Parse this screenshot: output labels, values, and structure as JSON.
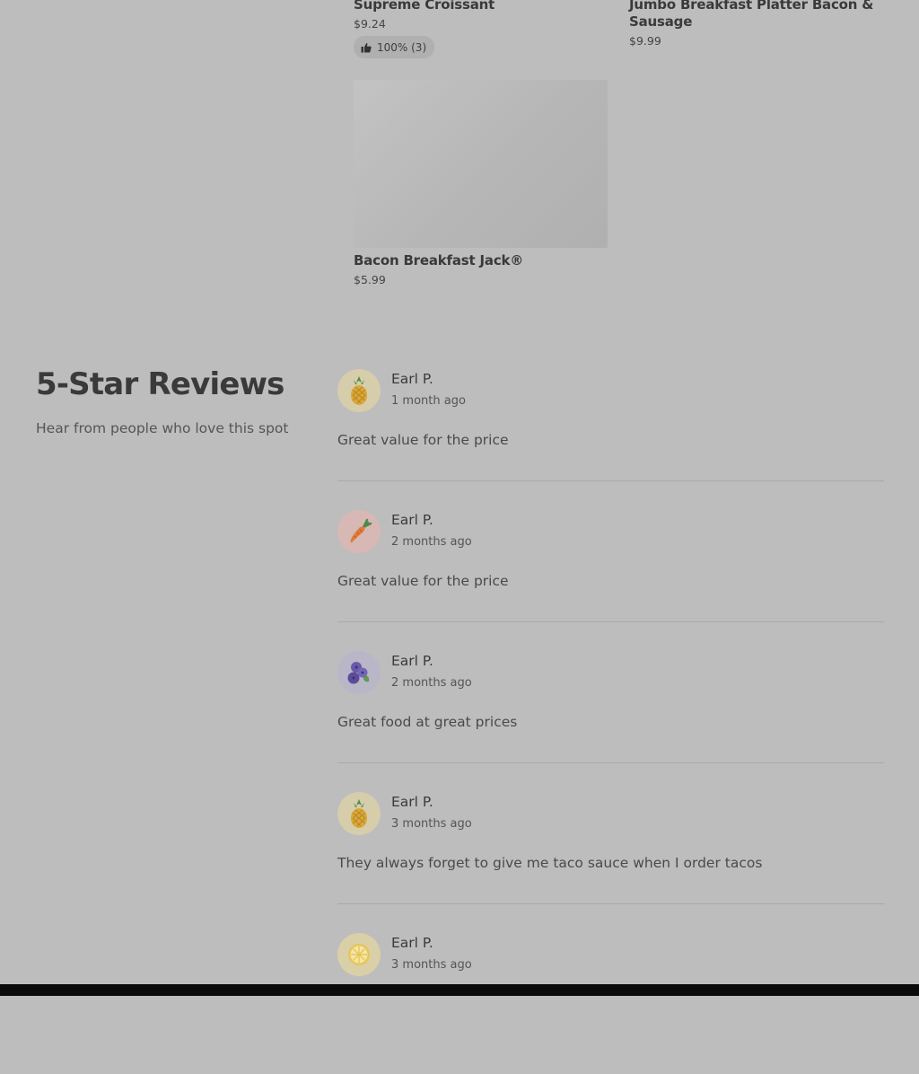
{
  "menu_items": [
    {
      "name": "Supreme Croissant",
      "price": "$9.24",
      "rating": "100% (3)"
    },
    {
      "name": "Jumbo Breakfast Platter Bacon & Sausage",
      "price": "$9.99"
    },
    {
      "name": "Bacon Breakfast Jack®",
      "price": "$5.99"
    }
  ],
  "reviews_section": {
    "title": "5-Star Reviews",
    "subtitle": "Hear from people who love this spot",
    "reviews": [
      {
        "author": "Earl P.",
        "date": "1 month ago",
        "text": "Great value for the price",
        "avatar": "pineapple-icon"
      },
      {
        "author": "Earl P.",
        "date": "2 months ago",
        "text": "Great value for the price",
        "avatar": "carrot-icon"
      },
      {
        "author": "Earl P.",
        "date": "2 months ago",
        "text": "Great food at great prices",
        "avatar": "blueberry-icon"
      },
      {
        "author": "Earl P.",
        "date": "3 months ago",
        "text": "They always forget to give me taco sauce when I order tacos",
        "avatar": "pineapple-icon"
      },
      {
        "author": "Earl P.",
        "date": "3 months ago",
        "text": "",
        "avatar": "lemon-icon"
      }
    ]
  },
  "colors": {
    "overlay_background": "#bdbdbd",
    "avatar_pineapple_bg": "#d6cdaa",
    "avatar_carrot_bg": "#d8b8b4",
    "avatar_blueberry_bg": "#b9b6c8",
    "avatar_lemon_bg": "#d9d0a8"
  }
}
